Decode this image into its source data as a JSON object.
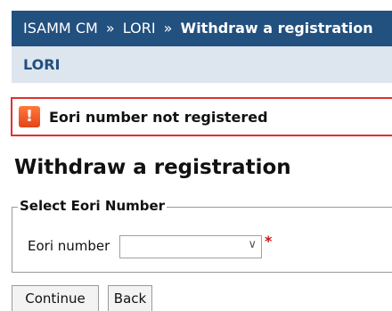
{
  "breadcrumb": {
    "items": [
      "ISAMM CM",
      "LORI"
    ],
    "separator": "»",
    "current": "Withdraw a registration"
  },
  "app_bar": {
    "title": "LORI"
  },
  "error": {
    "message": "Eori number not registered",
    "icon": "error-exclamation-icon"
  },
  "page": {
    "title": "Withdraw a registration"
  },
  "form": {
    "legend": "Select Eori Number",
    "eori_label": "Eori number",
    "eori_value": "",
    "required_marker": "*"
  },
  "buttons": {
    "continue_label": "Continue",
    "back_label": "Back"
  },
  "colors": {
    "header_bg": "#22507f",
    "subheader_bg": "#dde5ee",
    "error_border": "#e03030",
    "required": "#d01010"
  }
}
